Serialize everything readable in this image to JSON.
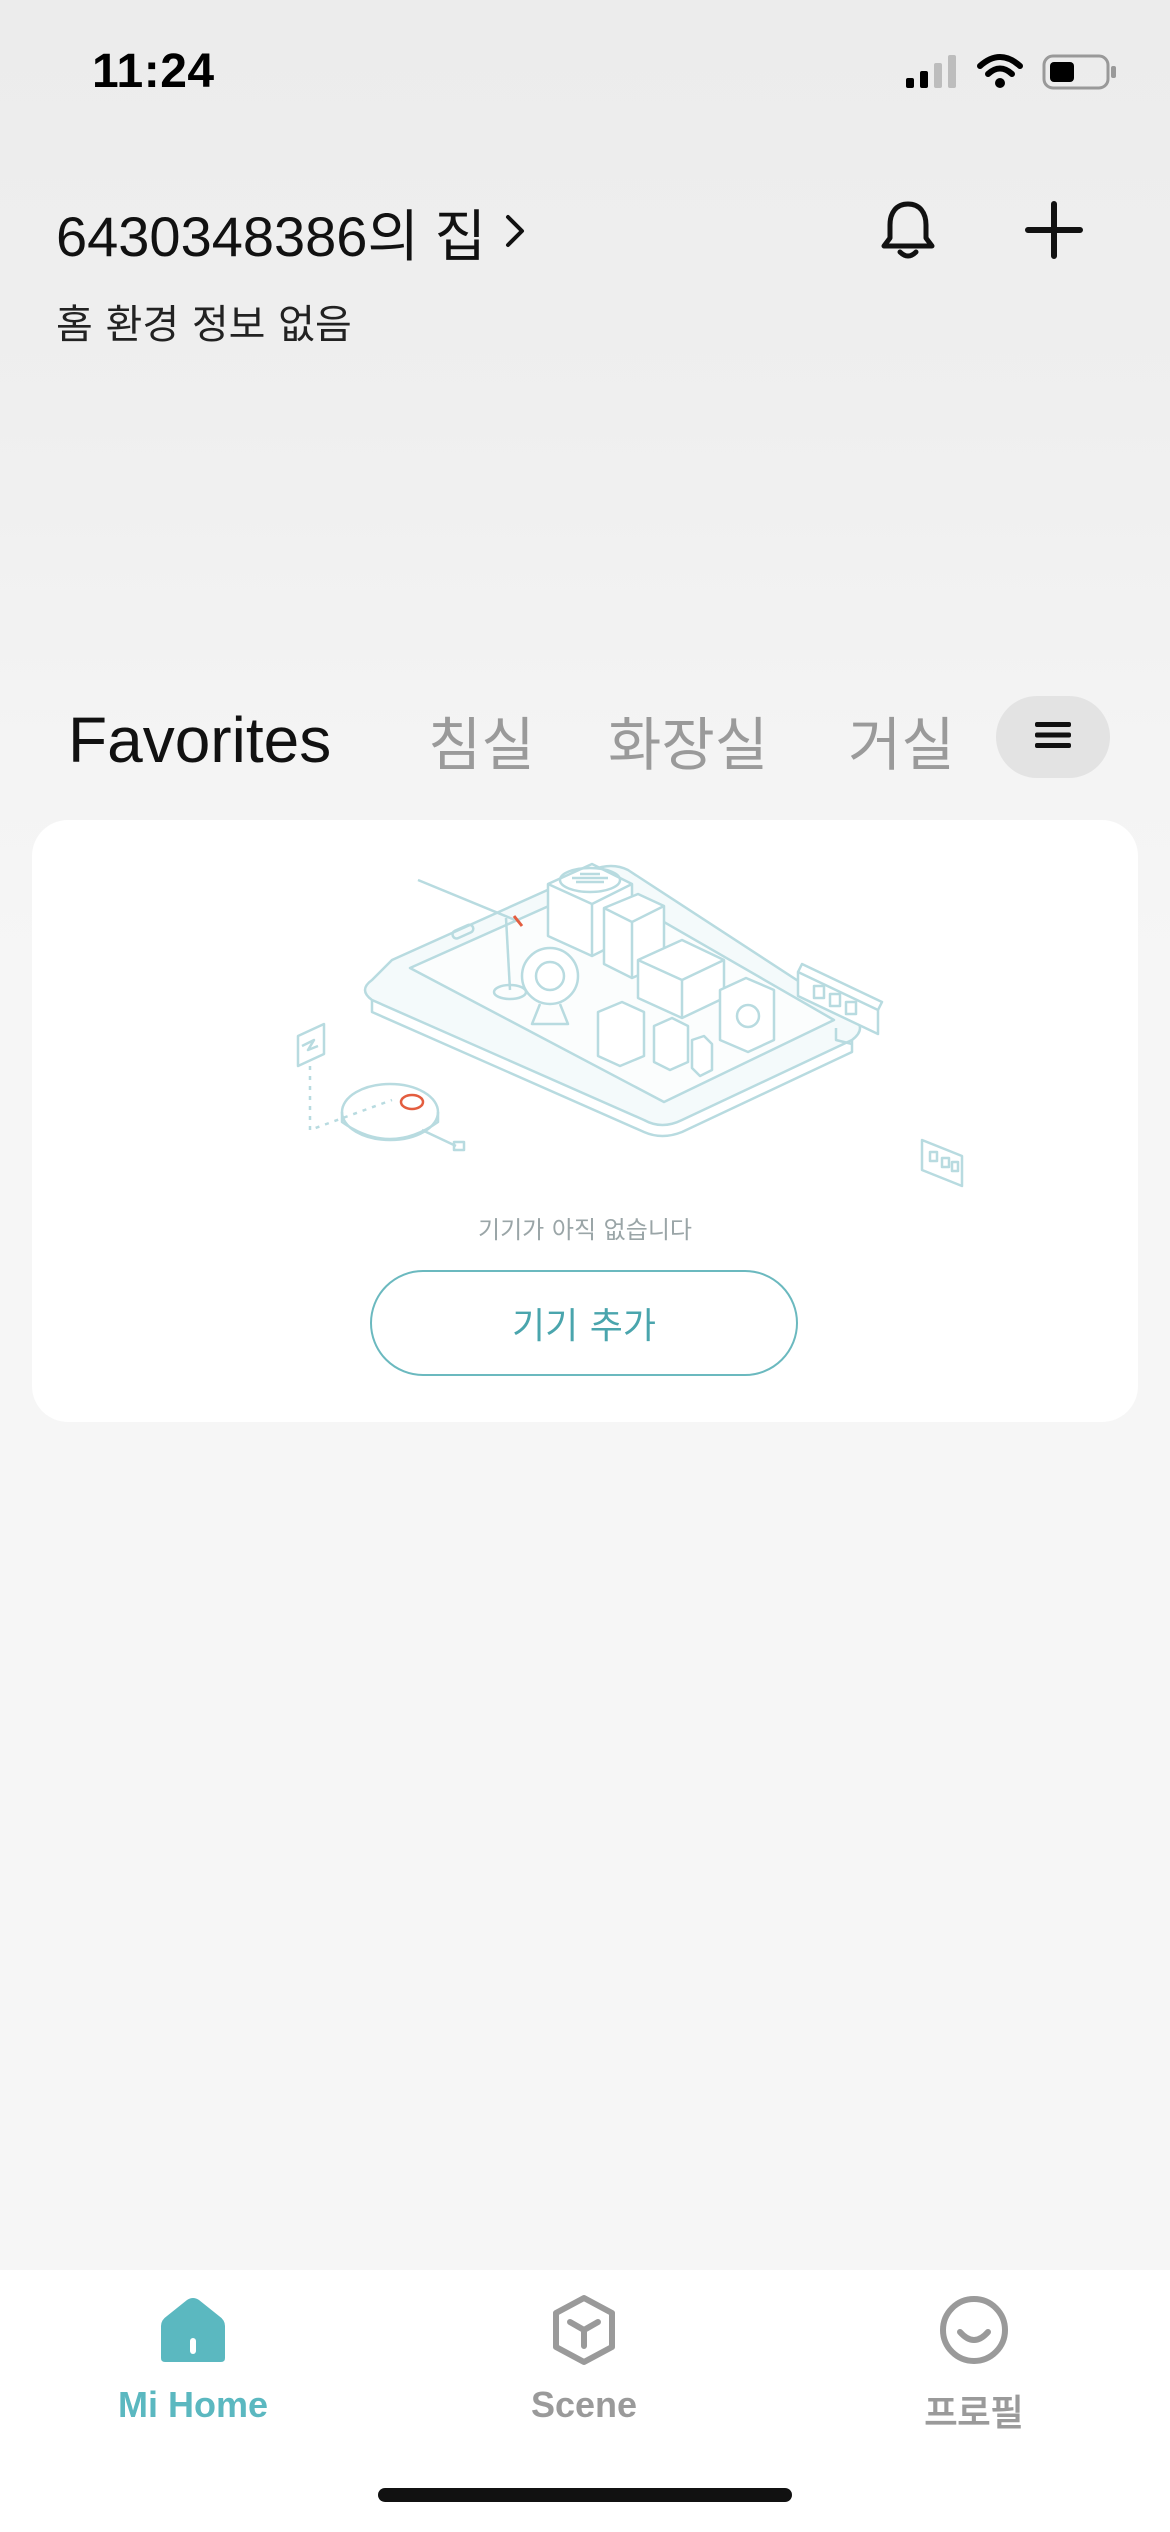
{
  "status_bar": {
    "time": "11:24",
    "icons": [
      "signal-icon",
      "wifi-icon",
      "battery-icon"
    ]
  },
  "header": {
    "home_name": "6430348386의 집",
    "chevron": "›",
    "subtitle": "홈 환경 정보 없음",
    "actions": [
      "bell-icon",
      "plus-icon"
    ]
  },
  "tabs": {
    "items": [
      {
        "label": "Favorites",
        "active": true
      },
      {
        "label": "침실",
        "active": false
      },
      {
        "label": "화장실",
        "active": false
      },
      {
        "label": "거실",
        "active": false
      }
    ],
    "menu_icon": "hamburger-icon"
  },
  "empty_state": {
    "message": "기기가 아직 없습니다",
    "button_label": "기기 추가"
  },
  "bottom_nav": {
    "items": [
      {
        "label": "Mi Home",
        "icon": "home-icon",
        "active": true
      },
      {
        "label": "Scene",
        "icon": "cube-icon",
        "active": false
      },
      {
        "label": "프로필",
        "icon": "smile-icon",
        "active": false
      }
    ]
  },
  "colors": {
    "accent": "#5bb8c0",
    "inactive": "#9a9a9a",
    "card_bg": "#ffffff",
    "page_bg": "#f6f6f6"
  }
}
